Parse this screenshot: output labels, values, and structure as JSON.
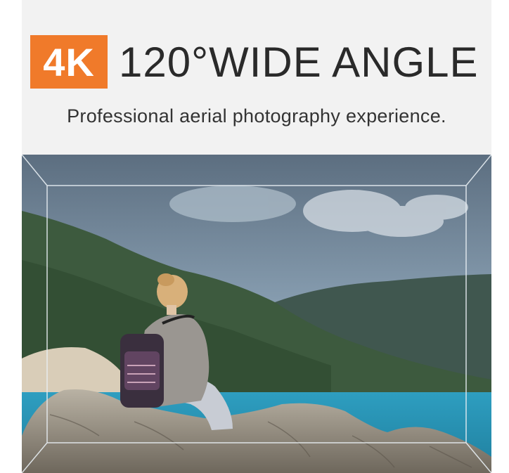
{
  "header": {
    "badge": "4K",
    "title": "120°WIDE ANGLE",
    "subtitle": "Professional aerial photography experience."
  },
  "colors": {
    "badge_bg": "#f07a2a",
    "header_bg": "#f2f2f2",
    "title_text": "#2a2a2a",
    "sea": "#2a8fb0"
  },
  "photo": {
    "subject": "woman-sitting-on-rocks-overlooking-sea-and-mountains"
  }
}
